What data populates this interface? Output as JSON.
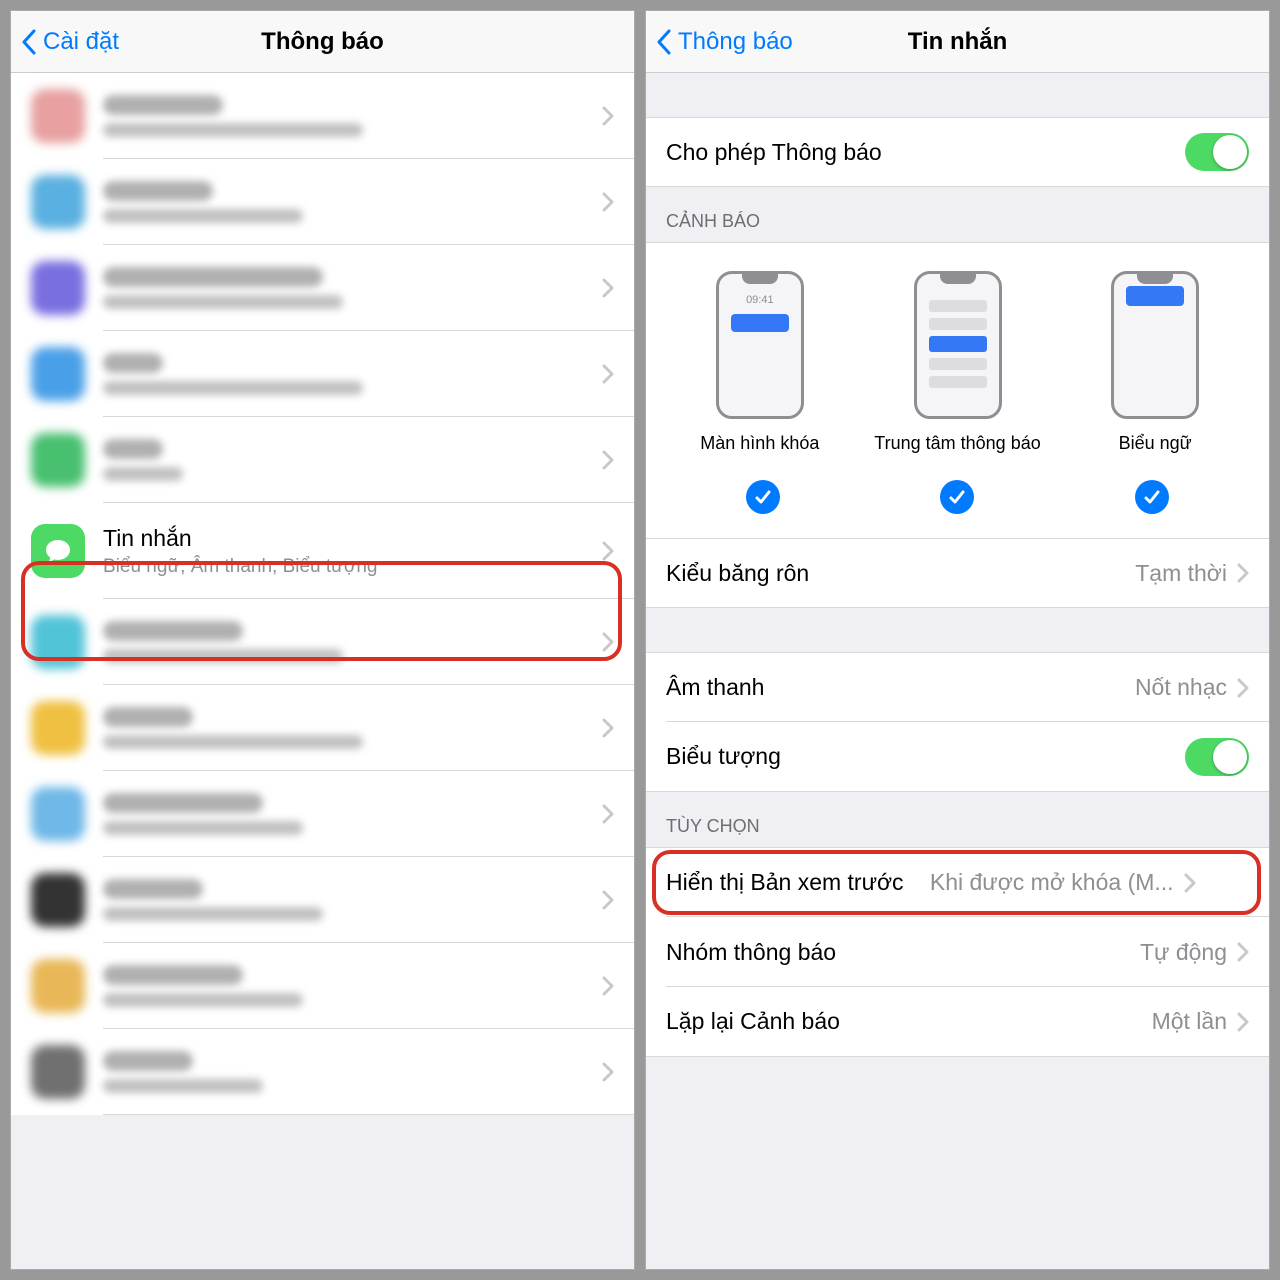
{
  "left": {
    "back_label": "Cài đặt",
    "title": "Thông báo",
    "messages_row": {
      "title": "Tin nhắn",
      "subtitle": "Biểu ngữ, Âm thanh, Biểu tượng"
    },
    "placeholder_rows": [
      {
        "icon_color": "#e8a0a0",
        "blurred": true,
        "title_w": 120,
        "sub_w": 260
      },
      {
        "icon_color": "#5ab0e0",
        "blurred": true,
        "title_w": 110,
        "sub_w": 200
      },
      {
        "icon_color": "#7a6fe0",
        "blurred": true,
        "title_w": 220,
        "sub_w": 240
      },
      {
        "icon_color": "#4aa0e8",
        "blurred": true,
        "title_w": 60,
        "sub_w": 260
      },
      {
        "icon_color": "#48c070",
        "blurred": true,
        "title_w": 60,
        "sub_w": 80
      },
      {
        "icon_color": "#52c4d8",
        "blurred": true,
        "title_w": 140,
        "sub_w": 240
      },
      {
        "icon_color": "#f0c040",
        "blurred": true,
        "title_w": 90,
        "sub_w": 260
      },
      {
        "icon_color": "#6fb8e8",
        "blurred": true,
        "title_w": 160,
        "sub_w": 200
      },
      {
        "icon_color": "#333333",
        "blurred": true,
        "title_w": 100,
        "sub_w": 220
      },
      {
        "icon_color": "#e8b858",
        "blurred": true,
        "title_w": 140,
        "sub_w": 200
      },
      {
        "icon_color": "#707070",
        "blurred": true,
        "title_w": 90,
        "sub_w": 160
      }
    ]
  },
  "right": {
    "back_label": "Thông báo",
    "title": "Tin nhắn",
    "allow_label": "Cho phép Thông báo",
    "section_alerts": "CẢNH BÁO",
    "alerts": {
      "lock_time": "09:41",
      "items": [
        {
          "label": "Màn hình khóa"
        },
        {
          "label": "Trung tâm thông báo"
        },
        {
          "label": "Biểu ngữ"
        }
      ]
    },
    "banner_style_label": "Kiểu băng rôn",
    "banner_style_value": "Tạm thời",
    "sound_label": "Âm thanh",
    "sound_value": "Nốt nhạc",
    "badge_label": "Biểu tượng",
    "section_options": "TÙY CHỌN",
    "preview_label": "Hiển thị Bản xem trước",
    "preview_value": "Khi được mở khóa (M...",
    "grouping_label": "Nhóm thông báo",
    "grouping_value": "Tự động",
    "repeat_label": "Lặp lại Cảnh báo",
    "repeat_value": "Một lần"
  }
}
